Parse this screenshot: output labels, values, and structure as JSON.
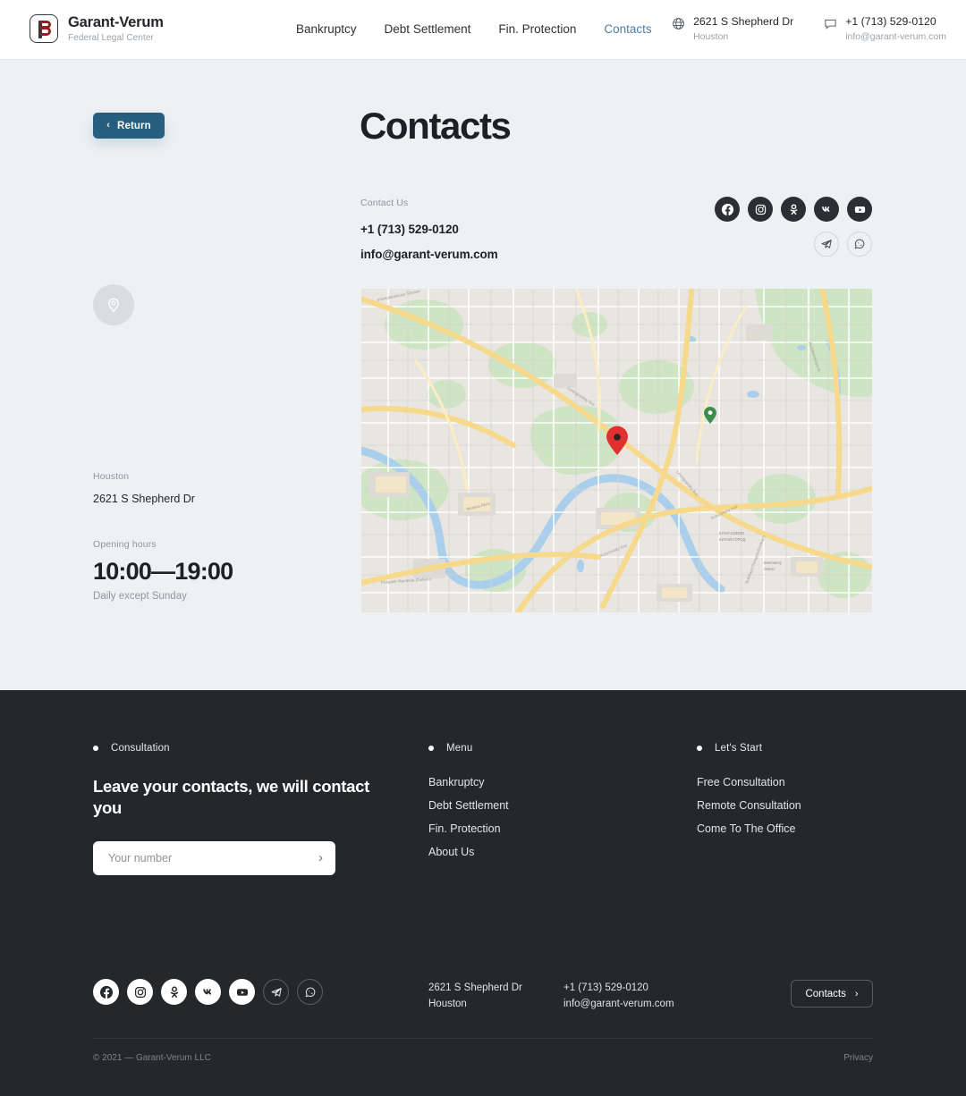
{
  "header": {
    "brand": "Garant-Verum",
    "tagline": "Federal Legal Center",
    "logo_icon": "gv-monogram-logo",
    "nav": [
      {
        "label": "Bankruptcy",
        "active": false
      },
      {
        "label": "Debt Settlement",
        "active": false
      },
      {
        "label": "Fin. Protection",
        "active": false
      },
      {
        "label": "Contacts",
        "active": true
      }
    ],
    "address_icon": "globe-icon",
    "address_main": "2621 S Shepherd Dr",
    "address_sub": "Houston",
    "contact_icon": "chat-bubble-icon",
    "contact_main": "+1 (713) 529-0120",
    "contact_sub": "info@garant-verum.com"
  },
  "main": {
    "return_label": "Return",
    "return_icon": "chevron-left-icon",
    "pin_icon": "map-pin-icon",
    "city_label": "Houston",
    "street_value": "2621 S Shepherd Dr",
    "hours_label": "Opening hours",
    "hours_value": "10:00—19:00",
    "hours_sub": "Daily except Sunday",
    "page_title": "Contacts",
    "contact_us_label": "Contact Us",
    "phone": "+1 (713) 529-0120",
    "email": "info@garant-verum.com",
    "socials_filled": [
      "facebook-icon",
      "instagram-icon",
      "odnoklassniki-icon",
      "vk-icon",
      "youtube-icon"
    ],
    "socials_outline": [
      "telegram-icon",
      "whatsapp-icon"
    ],
    "map": {
      "marker_color": "#e03030",
      "secondary_marker_color": "#3c8f4a",
      "land_color": "#e9e6e1",
      "road_color": "#ffffff",
      "highway_color": "#f6d98b",
      "park_color": "#cfe4c4",
      "water_color": "#a9cfec"
    }
  },
  "footer": {
    "col1": {
      "head": "Consultation",
      "cta": "Leave your contacts, we will contact you",
      "input_placeholder": "Your number",
      "input_value": "",
      "submit_icon": "chevron-right-icon"
    },
    "col2": {
      "head": "Menu",
      "links": [
        "Bankruptcy",
        "Debt Settlement",
        "Fin. Protection",
        "About Us"
      ]
    },
    "col3": {
      "head": "Let's Start",
      "links": [
        "Free Consultation",
        "Remote Consultation",
        "Come To The Office"
      ]
    },
    "socials_light": [
      "facebook-icon",
      "instagram-icon",
      "odnoklassniki-icon",
      "vk-icon",
      "youtube-icon"
    ],
    "socials_outline": [
      "telegram-icon",
      "whatsapp-icon"
    ],
    "address_line1": "2621 S Shepherd Dr",
    "address_line2": "Houston",
    "contact_line1": "+1 (713) 529-0120",
    "contact_line2": "info@garant-verum.com",
    "contacts_btn": "Contacts",
    "contacts_btn_icon": "chevron-right-icon",
    "copyright": "© 2021 — Garant-Verum LLC",
    "privacy": "Privacy"
  },
  "colors": {
    "page_bg": "#eef1f4",
    "header_bg": "#ffffff",
    "footer_bg": "#25282a",
    "accent_blue": "#4b7ea6",
    "return_btn_bg": "#255e7f",
    "brand_red": "#9b1c1c"
  }
}
